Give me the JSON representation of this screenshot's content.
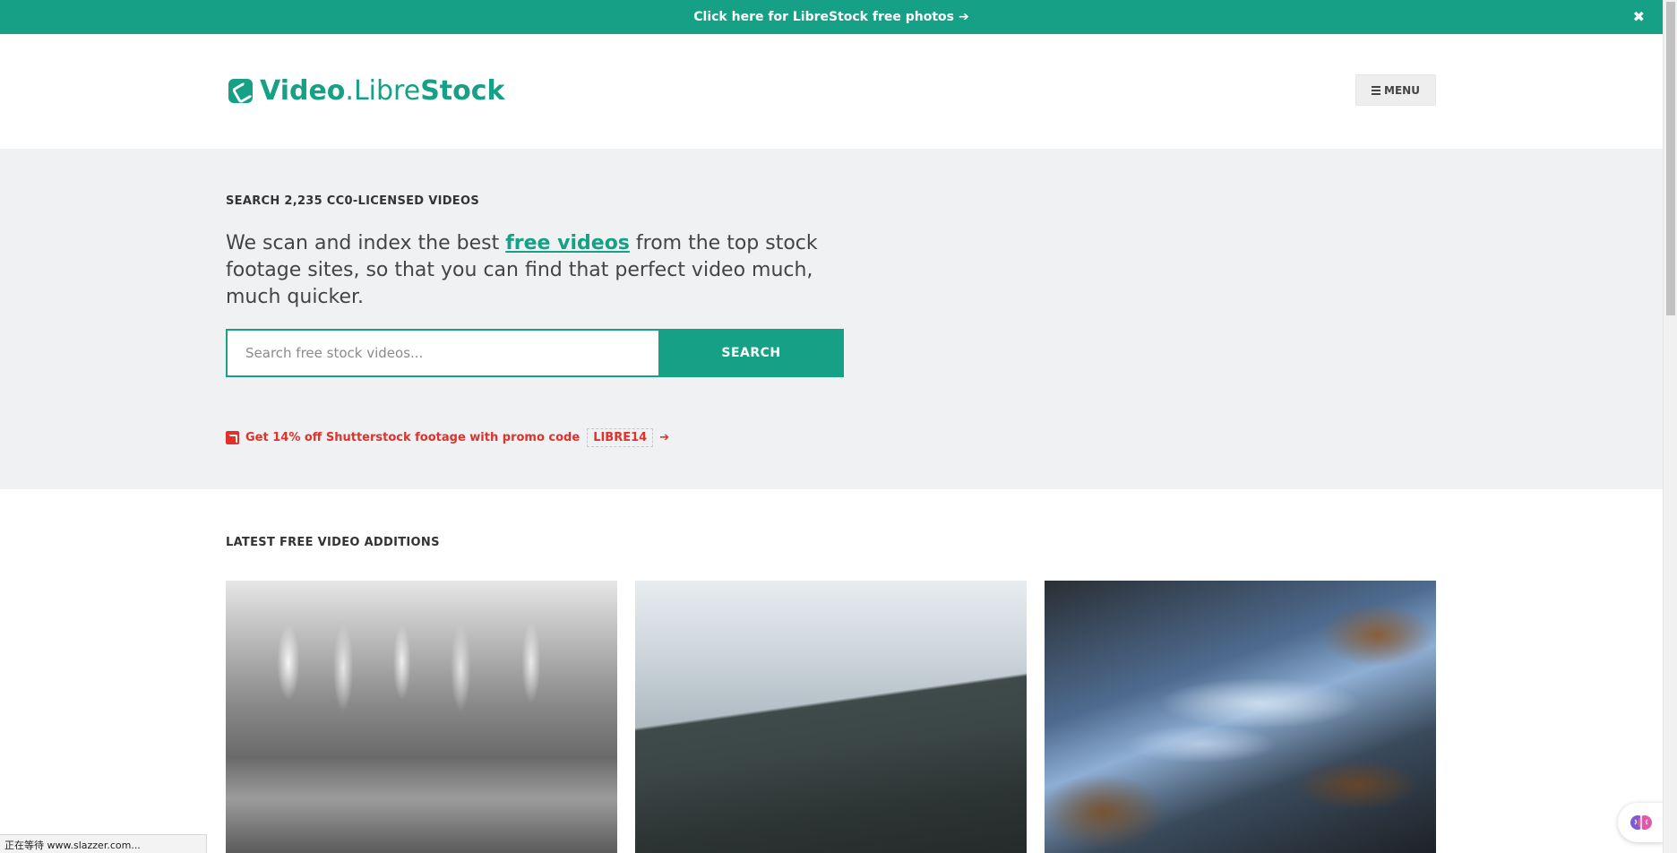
{
  "banner": {
    "text": "Click here for LibreStock free photos",
    "arrow": "➔",
    "close_icon": "✖"
  },
  "header": {
    "logo_part1": "Video",
    "logo_dot": ".",
    "logo_part2": "Libre",
    "logo_part3": "Stock",
    "menu_label": "MENU"
  },
  "hero": {
    "heading": "SEARCH 2,235 CC0-LICENSED VIDEOS",
    "intro_before": "We scan and index the best ",
    "intro_link": "free videos",
    "intro_after": " from the top stock footage sites, so that you can find that perfect video much, much quicker.",
    "search_placeholder": "Search free stock videos...",
    "search_button": "SEARCH",
    "promo_text": "Get 14% off Shutterstock footage with promo code",
    "promo_code": "LIBRE14",
    "promo_arrow": "➔"
  },
  "latest": {
    "heading": "LATEST FREE VIDEO ADDITIONS",
    "videos": [
      {
        "icon": "icicles-thumbnail"
      },
      {
        "icon": "mountain-thumbnail"
      },
      {
        "icon": "stream-thumbnail"
      }
    ]
  },
  "status_bar": {
    "text": "正在等待 www.slazzer.com..."
  },
  "colors": {
    "brand": "#16a085",
    "promo": "#e0312b",
    "hero_bg": "#f0f1f2"
  }
}
